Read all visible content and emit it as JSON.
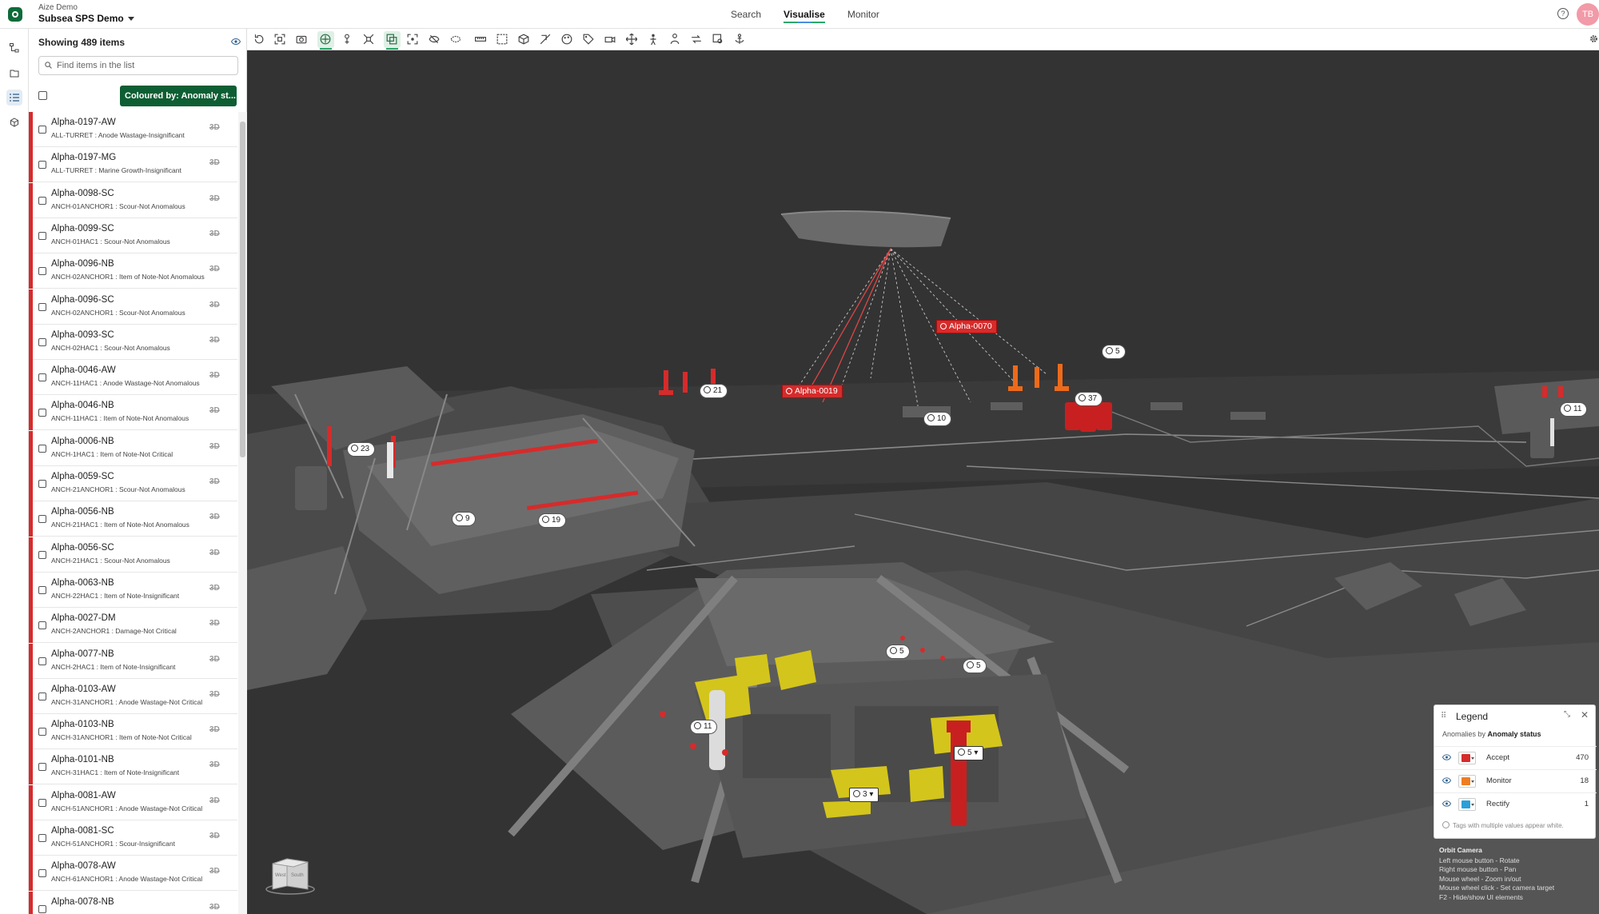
{
  "app": {
    "org": "Aize Demo",
    "project": "Subsea SPS Demo",
    "nav": [
      "Search",
      "Visualise",
      "Monitor"
    ],
    "active_nav": "Visualise",
    "avatar": "TB"
  },
  "rail": {
    "icons": [
      "hierarchy-icon",
      "documents-icon",
      "list-icon",
      "models-icon"
    ],
    "active": "list-icon"
  },
  "panel": {
    "header": "Showing 489 items",
    "search_placeholder": "Find items in the list",
    "coloured_by": "Coloured by: Anomaly st...",
    "items": [
      {
        "title": "Alpha-0197-AW",
        "subtitle": "ALL-TURRET : Anode Wastage-Insignificant"
      },
      {
        "title": "Alpha-0197-MG",
        "subtitle": "ALL-TURRET : Marine Growth-Insignificant"
      },
      {
        "title": "Alpha-0098-SC",
        "subtitle": "ANCH-01ANCHOR1 : Scour-Not Anomalous"
      },
      {
        "title": "Alpha-0099-SC",
        "subtitle": "ANCH-01HAC1 : Scour-Not Anomalous"
      },
      {
        "title": "Alpha-0096-NB",
        "subtitle": "ANCH-02ANCHOR1 : Item of Note-Not Anomalous"
      },
      {
        "title": "Alpha-0096-SC",
        "subtitle": "ANCH-02ANCHOR1 : Scour-Not Anomalous"
      },
      {
        "title": "Alpha-0093-SC",
        "subtitle": "ANCH-02HAC1 : Scour-Not Anomalous"
      },
      {
        "title": "Alpha-0046-AW",
        "subtitle": "ANCH-11HAC1 : Anode Wastage-Not Anomalous"
      },
      {
        "title": "Alpha-0046-NB",
        "subtitle": "ANCH-11HAC1 : Item of Note-Not Anomalous"
      },
      {
        "title": "Alpha-0006-NB",
        "subtitle": "ANCH-1HAC1 : Item of Note-Not Critical"
      },
      {
        "title": "Alpha-0059-SC",
        "subtitle": "ANCH-21ANCHOR1 : Scour-Not Anomalous"
      },
      {
        "title": "Alpha-0056-NB",
        "subtitle": "ANCH-21HAC1 : Item of Note-Not Anomalous"
      },
      {
        "title": "Alpha-0056-SC",
        "subtitle": "ANCH-21HAC1 : Scour-Not Anomalous"
      },
      {
        "title": "Alpha-0063-NB",
        "subtitle": "ANCH-22HAC1 : Item of Note-Insignificant"
      },
      {
        "title": "Alpha-0027-DM",
        "subtitle": "ANCH-2ANCHOR1 : Damage-Not Critical"
      },
      {
        "title": "Alpha-0077-NB",
        "subtitle": "ANCH-2HAC1 : Item of Note-Insignificant"
      },
      {
        "title": "Alpha-0103-AW",
        "subtitle": "ANCH-31ANCHOR1 : Anode Wastage-Not Critical"
      },
      {
        "title": "Alpha-0103-NB",
        "subtitle": "ANCH-31ANCHOR1 : Item of Note-Not Critical"
      },
      {
        "title": "Alpha-0101-NB",
        "subtitle": "ANCH-31HAC1 : Item of Note-Insignificant"
      },
      {
        "title": "Alpha-0081-AW",
        "subtitle": "ANCH-51ANCHOR1 : Anode Wastage-Not Critical"
      },
      {
        "title": "Alpha-0081-SC",
        "subtitle": "ANCH-51ANCHOR1 : Scour-Insignificant"
      },
      {
        "title": "Alpha-0078-AW",
        "subtitle": "ANCH-61ANCHOR1 : Anode Wastage-Not Critical"
      },
      {
        "title": "Alpha-0078-NB",
        "subtitle": ""
      }
    ],
    "row_badge": "3D"
  },
  "toolbar": {
    "icons": [
      "reset-view-icon",
      "fit-view-icon",
      "screenshot-icon",
      "select-mode-icon",
      "measure-point-icon",
      "explode-icon",
      "isolate-icon",
      "focus-icon",
      "hide-icon",
      "ghost-icon",
      "ruler-icon",
      "section-box-icon",
      "cube-view-icon",
      "clip-icon",
      "color-icon",
      "tag-icon",
      "camera-icon",
      "pan-icon",
      "walk-icon",
      "person-icon",
      "reload-icon",
      "search-view-icon",
      "anchor-icon"
    ],
    "active": [
      "select-mode-icon",
      "isolate-icon"
    ],
    "settings": "gear-icon"
  },
  "scene": {
    "count_tags": [
      "5",
      "21",
      "10",
      "37",
      "11",
      "23",
      "9",
      "19",
      "5",
      "5",
      "11",
      "5",
      "3"
    ],
    "anomaly_labels": [
      "Alpha-0070",
      "Alpha-0019"
    ]
  },
  "legend": {
    "title": "Legend",
    "subtitle_prefix": "Anomalies by",
    "subtitle_field": "Anomaly status",
    "rows": [
      {
        "label": "Accept",
        "count": "470",
        "color": "#d62b2b"
      },
      {
        "label": "Monitor",
        "count": "18",
        "color": "#ee7d22"
      },
      {
        "label": "Rectify",
        "count": "1",
        "color": "#2b9fd8"
      }
    ],
    "note": "Tags with multiple values appear white."
  },
  "camera_help": {
    "title": "Orbit Camera",
    "lines": [
      "Left mouse button - Rotate",
      "Right mouse button - Pan",
      "Mouse wheel - Zoom in/out",
      "Mouse wheel click - Set camera target",
      "F2 - Hide/show UI elements"
    ]
  },
  "view_cube": {
    "faces": [
      "West",
      "South"
    ]
  }
}
